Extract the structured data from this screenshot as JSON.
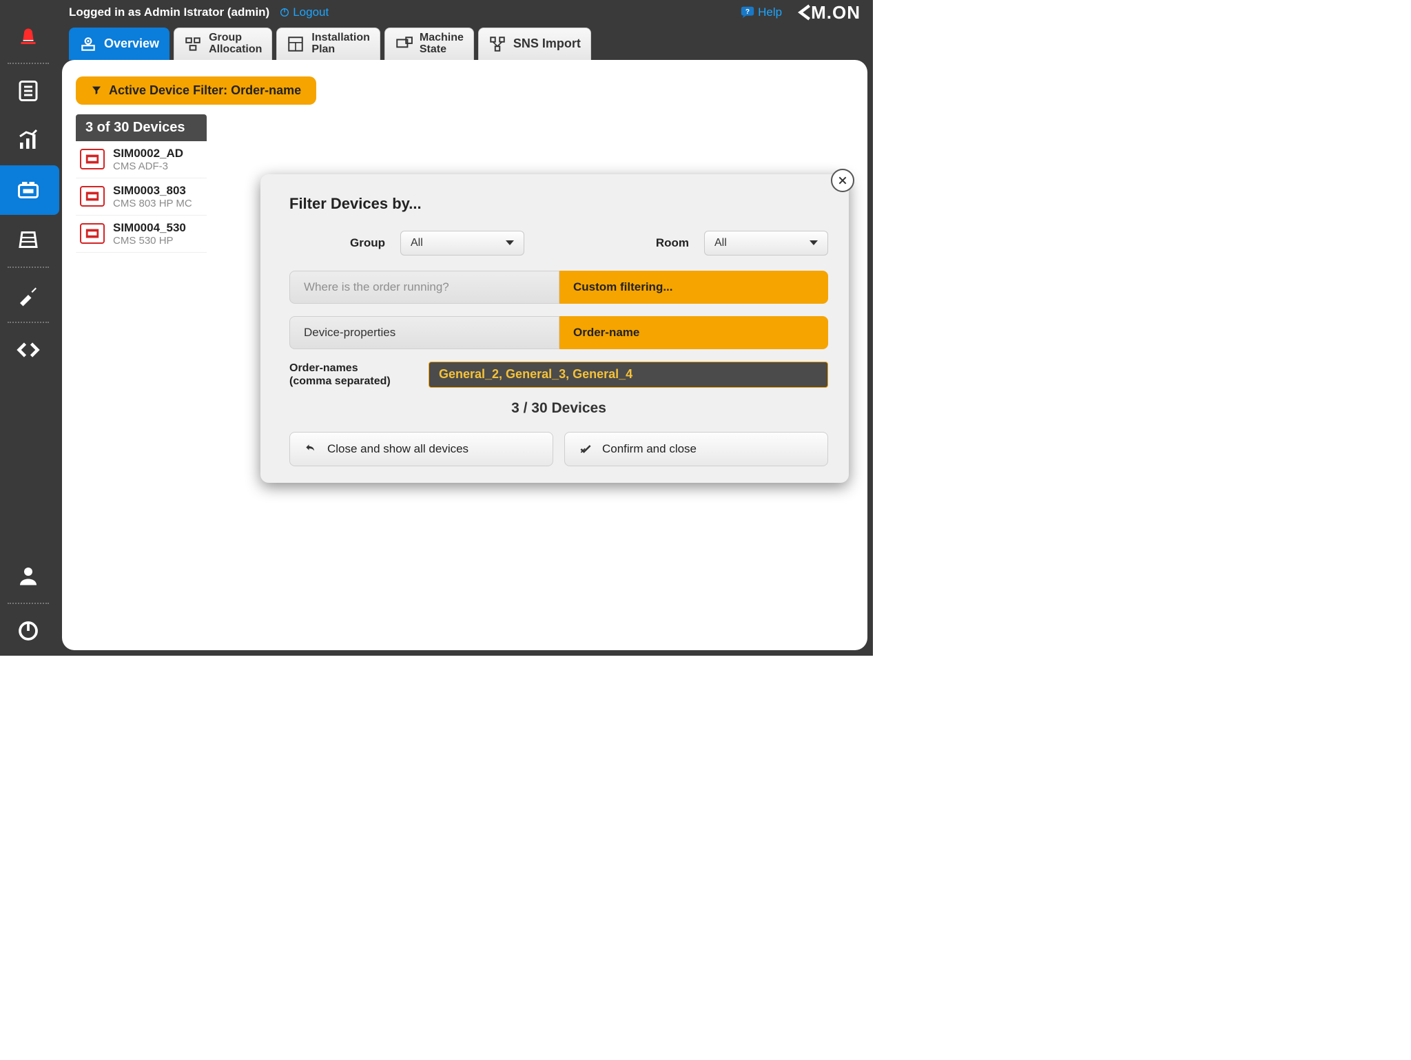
{
  "header": {
    "logged_in": "Logged in as Admin Istrator (admin)",
    "logout_label": "Logout",
    "help_label": "Help",
    "brand_1": "K",
    "brand_2": "M.ON"
  },
  "tabs": {
    "overview": "Overview",
    "group_l1": "Group",
    "group_l2": "Allocation",
    "install_l1": "Installation",
    "install_l2": "Plan",
    "machine_l1": "Machine",
    "machine_l2": "State",
    "sns": "SNS Import"
  },
  "filter_chip": "Active Device Filter: Order-name",
  "device_count": "3 of 30 Devices",
  "devices": [
    {
      "name": "SIM0002_AD",
      "sub": "CMS ADF-3"
    },
    {
      "name": "SIM0003_803",
      "sub": "CMS 803 HP MC"
    },
    {
      "name": "SIM0004_530",
      "sub": "CMS 530 HP"
    }
  ],
  "modal": {
    "title": "Filter Devices by...",
    "group_label": "Group",
    "group_value": "All",
    "room_label": "Room",
    "room_value": "All",
    "seg1_left": "Where is the order running?",
    "seg1_right": "Custom filtering...",
    "seg2_left": "Device-properties",
    "seg2_right": "Order-name",
    "input_label_l1": "Order-names",
    "input_label_l2": "(comma separated)",
    "input_value": "General_2, General_3, General_4",
    "match_count": "3 / 30 Devices",
    "close_all": "Close and show all devices",
    "confirm": "Confirm and close"
  }
}
